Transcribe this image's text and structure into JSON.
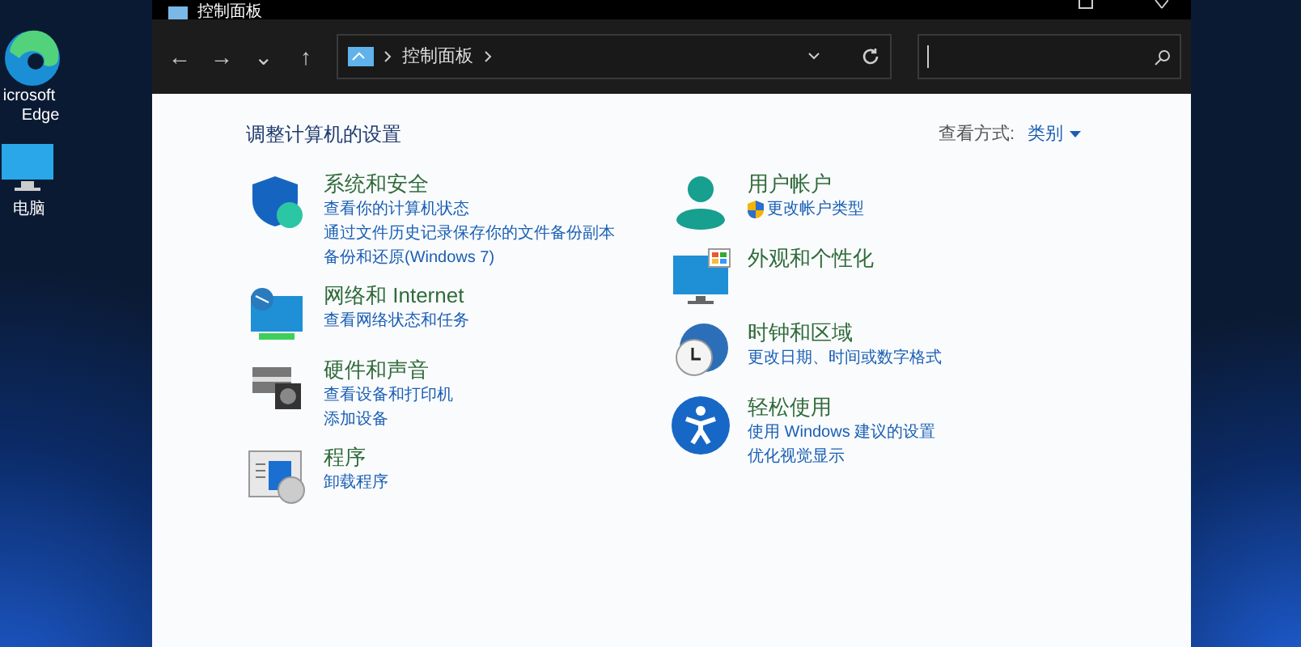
{
  "desktop": {
    "icons": [
      {
        "kind": "edge",
        "label": "icrosoft",
        "label2": "Edge"
      },
      {
        "kind": "pc",
        "label": "电脑"
      }
    ]
  },
  "window": {
    "title": "控制面板"
  },
  "toolbar": {
    "nav": [
      "←",
      "→",
      "⌄",
      "↑"
    ],
    "breadcrumb": [
      "控制面板"
    ]
  },
  "content": {
    "heading": "调整计算机的设置",
    "view_by_label": "查看方式:",
    "view_by_value": "类别",
    "left": [
      {
        "kind": "security",
        "title": "系统和安全",
        "links": [
          {
            "text": "查看你的计算机状态",
            "shield": false
          },
          {
            "text": "通过文件历史记录保存你的文件备份副本",
            "shield": false
          },
          {
            "text": "备份和还原(Windows 7)",
            "shield": false
          }
        ]
      },
      {
        "kind": "network",
        "title": "网络和 Internet",
        "links": [
          {
            "text": "查看网络状态和任务",
            "shield": false
          }
        ]
      },
      {
        "kind": "hardware",
        "title": "硬件和声音",
        "links": [
          {
            "text": "查看设备和打印机",
            "shield": false
          },
          {
            "text": "添加设备",
            "shield": false
          }
        ]
      },
      {
        "kind": "programs",
        "title": "程序",
        "links": [
          {
            "text": "卸载程序",
            "shield": false
          }
        ]
      }
    ],
    "right": [
      {
        "kind": "user",
        "title": "用户帐户",
        "links": [
          {
            "text": "更改帐户类型",
            "shield": true
          }
        ]
      },
      {
        "kind": "appearance",
        "title": "外观和个性化"
      },
      {
        "kind": "clock",
        "title": "时钟和区域",
        "links": [
          {
            "text": "更改日期、时间或数字格式",
            "shield": false
          }
        ]
      },
      {
        "kind": "access",
        "title": "轻松使用",
        "links": [
          {
            "text": "使用 Windows 建议的设置",
            "shield": false
          },
          {
            "text": "优化视觉显示",
            "shield": false
          }
        ]
      }
    ]
  }
}
